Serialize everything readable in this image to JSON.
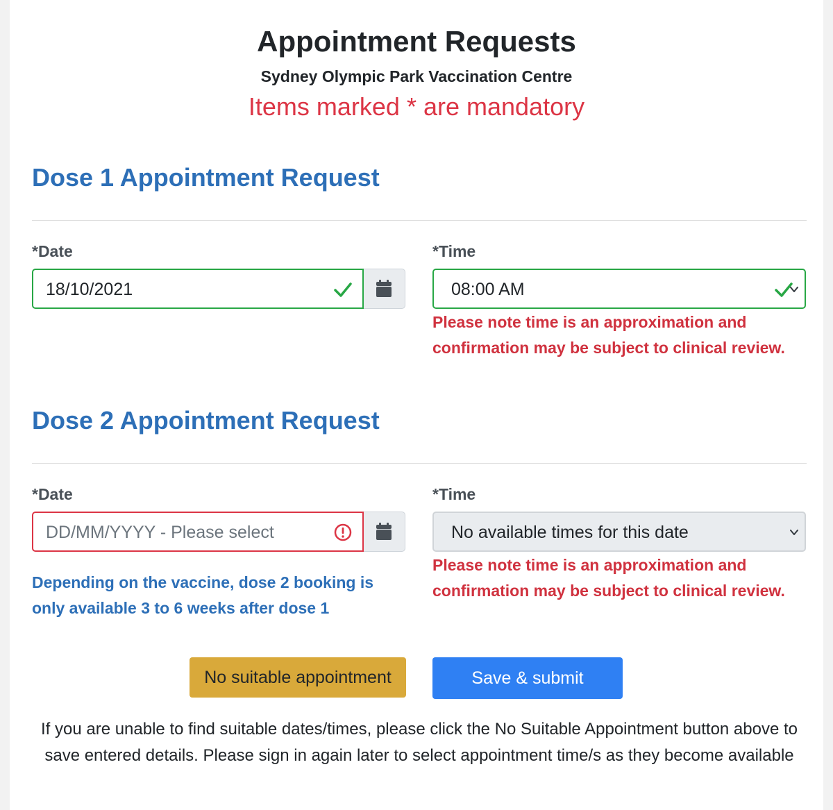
{
  "header": {
    "title": "Appointment Requests",
    "subtitle": "Sydney Olympic Park Vaccination Centre",
    "mandatory_note": "Items marked * are mandatory"
  },
  "dose1": {
    "title": "Dose 1 Appointment Request",
    "date_label": "*Date",
    "date_value": "18/10/2021",
    "time_label": "*Time",
    "time_value": "08:00 AM",
    "time_note": "Please note time is an approximation and confirmation may be subject to clinical review."
  },
  "dose2": {
    "title": "Dose 2 Appointment Request",
    "date_label": "*Date",
    "date_placeholder": "DD/MM/YYYY - Please select",
    "date_info": "Depending on the vaccine, dose 2 booking is only available 3 to 6 weeks after dose 1",
    "time_label": "*Time",
    "time_value": "No available times for this date",
    "time_note": "Please note time is an approximation and confirmation may be subject to clinical review."
  },
  "buttons": {
    "no_suitable": "No suitable appointment",
    "submit": "Save & submit"
  },
  "help_text": "If you are unable to find suitable dates/times, please click the No Suitable Appointment button above to save entered details. Please sign in again later to select appointment time/s as they become available",
  "icons": {
    "valid": "check-icon",
    "invalid": "exclamation-circle-icon",
    "calendar": "calendar-icon",
    "dropdown": "chevron-down-icon"
  },
  "colors": {
    "accent_blue": "#2d6fb7",
    "error_red": "#dc3545",
    "valid_green": "#28a745",
    "warning_gold": "#d9a93a",
    "primary_blue": "#2f80f3"
  }
}
